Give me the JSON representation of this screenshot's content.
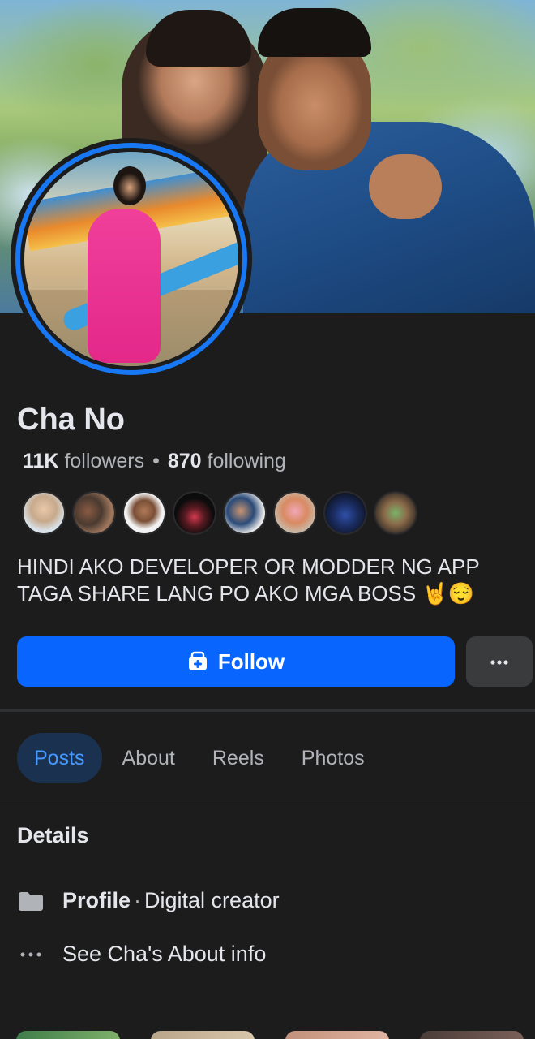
{
  "profile": {
    "name": "Cha No",
    "followers_count": "11K",
    "followers_label": "followers",
    "following_count": "870",
    "following_label": "following",
    "bio_line1": "HINDI AKO DEVELOPER OR MODDER NG APP",
    "bio_line2": "TAGA SHARE LANG PO AKO MGA BOSS 🤘😌"
  },
  "actions": {
    "follow_label": "Follow",
    "more_label": "···"
  },
  "tabs": [
    {
      "label": "Posts",
      "active": true
    },
    {
      "label": "About",
      "active": false
    },
    {
      "label": "Reels",
      "active": false
    },
    {
      "label": "Photos",
      "active": false
    }
  ],
  "details": {
    "title": "Details",
    "profile_label": "Profile",
    "profile_separator": "·",
    "profile_category": "Digital creator",
    "about_link": "See Cha's About info"
  },
  "colors": {
    "background": "#1c1c1d",
    "primary_blue": "#0866ff",
    "active_tab_bg": "#1b3150",
    "active_tab_text": "#4599ff",
    "secondary_text": "#b0b3b8"
  },
  "icons": {
    "follow": "add-friend-icon",
    "more": "more-dots-icon",
    "profile": "folder-icon",
    "about": "ellipsis-icon"
  }
}
